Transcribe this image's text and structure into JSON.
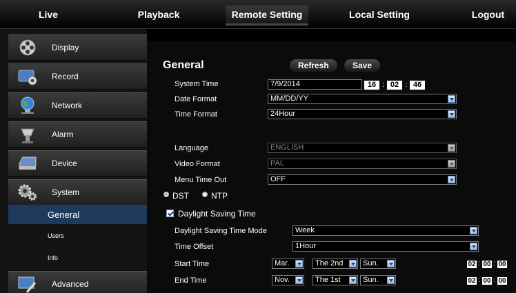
{
  "nav": {
    "tabs": [
      {
        "label": "Live"
      },
      {
        "label": "Playback"
      },
      {
        "label": "Remote Setting"
      },
      {
        "label": "Local Setting"
      },
      {
        "label": "Logout"
      }
    ],
    "active_index": 2
  },
  "sidebar": {
    "items": [
      {
        "label": "Display",
        "icon": "film-reel-icon"
      },
      {
        "label": "Record",
        "icon": "camera-record-icon"
      },
      {
        "label": "Network",
        "icon": "globe-network-icon"
      },
      {
        "label": "Alarm",
        "icon": "alarm-siren-icon"
      },
      {
        "label": "Device",
        "icon": "hard-drive-icon"
      },
      {
        "label": "System",
        "icon": "gears-icon"
      }
    ],
    "sub_items": [
      {
        "label": "General"
      },
      {
        "label": "Users"
      },
      {
        "label": "Info"
      }
    ],
    "advanced": {
      "label": "Advanced",
      "icon": "monitor-tools-icon"
    }
  },
  "general": {
    "title": "General",
    "refresh_label": "Refresh",
    "save_label": "Save",
    "system_time": {
      "label": "System Time",
      "date": "7/9/2014",
      "hh": "16",
      "mm": "02",
      "ss": "46"
    },
    "date_format": {
      "label": "Date Format",
      "value": "MM/DD/YY"
    },
    "time_format": {
      "label": "Time Format",
      "value": "24Hour"
    },
    "language": {
      "label": "Language",
      "value": "ENGLISH"
    },
    "video_format": {
      "label": "Video Format",
      "value": "PAL"
    },
    "menu_timeout": {
      "label": "Menu Time Out",
      "value": "OFF"
    },
    "dst_label": "DST",
    "ntp_label": "NTP",
    "daylight_saving": {
      "label": "Daylight Saving Time",
      "checked": true
    },
    "dst_mode": {
      "label": "Daylight Saving Time Mode",
      "value": "Week"
    },
    "time_offset": {
      "label": "Time Offset",
      "value": "1Hour"
    },
    "start_time": {
      "label": "Start Time",
      "month": "Mar.",
      "week": "The 2nd",
      "day": "Sun.",
      "hh": "02",
      "mm": "00",
      "ss": "00"
    },
    "end_time": {
      "label": "End Time",
      "month": "Nov.",
      "week": "The 1st",
      "day": "Sun.",
      "hh": "02",
      "mm": "00",
      "ss": "00"
    },
    "colon": ":"
  },
  "colors": {
    "selected_sub": "#1e3a5c",
    "field_border": "#7d7d7d"
  }
}
